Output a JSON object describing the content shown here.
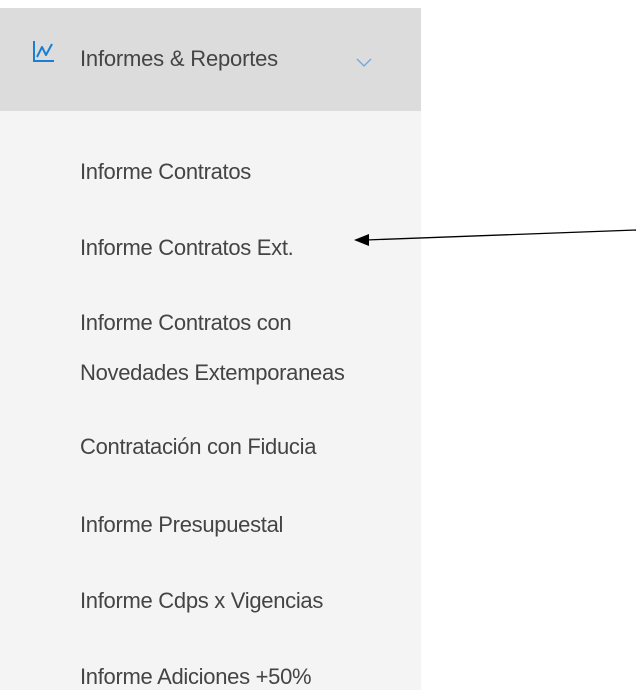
{
  "menu": {
    "header": {
      "label": "Informes & Reportes",
      "icon": "line-chart-icon",
      "chevron": "chevron-down-icon",
      "icon_color": "#1a7fd4"
    },
    "items": [
      {
        "label": "Informe Contratos"
      },
      {
        "label": "Informe Contratos Ext."
      },
      {
        "label": "Informe Contratos con"
      },
      {
        "label": "Novedades Extemporaneas"
      },
      {
        "label": "Contratación con Fiducia"
      },
      {
        "label": "Informe Presupuestal"
      },
      {
        "label": "Informe Cdps x Vigencias"
      },
      {
        "label": "Informe Adiciones +50%"
      }
    ]
  },
  "annotation": {
    "icon": "arrow-left-icon",
    "color": "#000000"
  }
}
